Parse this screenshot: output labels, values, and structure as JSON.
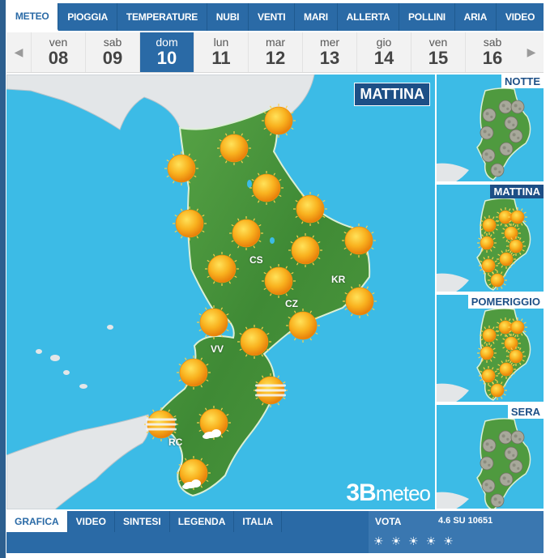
{
  "tabs": [
    "METEO",
    "PIOGGIA",
    "TEMPERATURE",
    "NUBI",
    "VENTI",
    "MARI",
    "ALLERTA",
    "POLLINI",
    "ARIA",
    "VIDEO"
  ],
  "days": [
    {
      "name": "ven",
      "num": "08"
    },
    {
      "name": "sab",
      "num": "09"
    },
    {
      "name": "dom",
      "num": "10"
    },
    {
      "name": "lun",
      "num": "11"
    },
    {
      "name": "mar",
      "num": "12"
    },
    {
      "name": "mer",
      "num": "13"
    },
    {
      "name": "gio",
      "num": "14"
    },
    {
      "name": "ven",
      "num": "15"
    },
    {
      "name": "sab",
      "num": "16"
    }
  ],
  "map": {
    "label": "MATTINA",
    "cities": [
      "CS",
      "KR",
      "CZ",
      "VV",
      "RC"
    ],
    "brand_prefix": "3B",
    "brand_suffix": "meteo"
  },
  "panels": [
    "NOTTE",
    "MATTINA",
    "POMERIGGIO",
    "SERA"
  ],
  "bottom_tabs": [
    "GRAFICA",
    "VIDEO",
    "SINTESI",
    "LEGENDA",
    "ITALIA"
  ],
  "vote": {
    "label": "VOTA",
    "score": "4.6 SU 10651",
    "rating_value": 4.6,
    "rating_max": 5
  },
  "colors": {
    "sea": "#3cbbe6",
    "land_calabria": "#4f9a3f",
    "land_other": "#e3e6e8",
    "tab_bar": "#2a6aa6",
    "label_bg": "#1d4f86",
    "sun": "#f6a414"
  },
  "icons": {
    "main_map": [
      "sun",
      "sun",
      "sun",
      "sun",
      "sun",
      "sun",
      "sun",
      "sun",
      "sun",
      "sun",
      "sun",
      "sun",
      "sun",
      "sun",
      "sun",
      "sun",
      "sun",
      "fog-sun",
      "fog-sun",
      "cloud-sun",
      "cloud-sun",
      "fog-sun"
    ],
    "night": "moon",
    "morning": "sun",
    "afternoon": "sun",
    "evening": "moon"
  }
}
